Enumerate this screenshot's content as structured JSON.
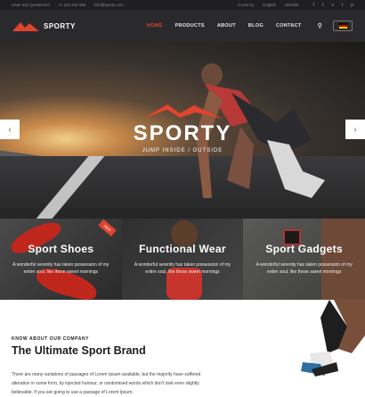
{
  "topbar": {
    "question": "Have any Questions?",
    "phone": "+1 123 444 555",
    "email": "info@sporty.com",
    "currency": "Currency",
    "language": "English",
    "wishlist": "Wishlist"
  },
  "nav": {
    "logo": "SPORTY",
    "items": [
      "HOME",
      "PRODUCTS",
      "ABOUT",
      "BLOG",
      "CONTACT"
    ],
    "active_index": 0
  },
  "hero": {
    "title": "SPORTY",
    "subtitle": "JUMP INSIDE / OUTSIDE",
    "prev": "‹",
    "next": "›"
  },
  "categories": [
    {
      "title": "Sport Shoes",
      "text": "A wonderful serenity has taken possession of my entire soul, like these sweet mornings",
      "badge": "NEW"
    },
    {
      "title": "Functional Wear",
      "text": "A wonderful serenity has taken possession of my entire soul, like these sweet mornings"
    },
    {
      "title": "Sport Gadgets",
      "text": "A wonderful serenity has taken possession of my entire soul, like these sweet mornings"
    }
  ],
  "about": {
    "kicker": "KNOW ABOUT OUR COMPANY",
    "title": "The Ultimate Sport Brand",
    "text": "There are many variations of passages of Lorem Ipsum available, but the majority have suffered alteration in some form, by injected humour, or randomised words which don't look even slightly believable. If you are going to use a passage of Lorem Ipsum."
  },
  "colors": {
    "accent": "#e0442e",
    "nav_bg": "#2a2a2c",
    "topbar_bg": "#1f1f21"
  }
}
